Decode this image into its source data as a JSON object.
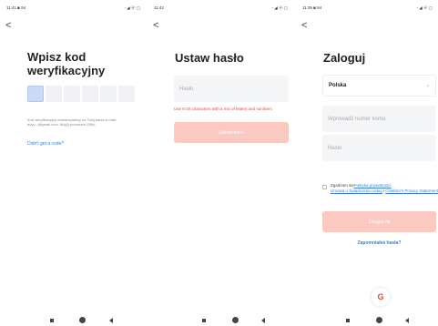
{
  "screen1": {
    "status_time": "11:41 ◙ 94",
    "status_right": "◦ ◢ ⓦ ▢",
    "back_glyph": "<",
    "title": "Wpisz kod weryfikacyjny",
    "code_boxes": 6,
    "info": "Kod weryfikacyjny został wysłany na Twój adres e-mail: adyv...@gmail.com. Mój(i) ponownie (59s)",
    "link": "Didn't get a code?"
  },
  "screen2": {
    "status_time": "11:42",
    "status_right": "◦ ◢ ⓦ ▢",
    "back_glyph": "<",
    "title": "Ustaw hasło",
    "password_placeholder": "Hasło",
    "hint": "Use 6-20 characters with a mix of letters and numbers",
    "button": "Zakończono"
  },
  "screen3": {
    "status_time": "11:39 ◙ 94",
    "status_right": "◦ ◢ ⓦ ▢",
    "back_glyph": "<",
    "title": "Zaloguj",
    "country": "Polska",
    "chevron": "⌄",
    "account_placeholder": "Wprowadź numer konta",
    "password_placeholder": "Hasło",
    "terms_prefix": "Zgadzam się",
    "terms_link1": "Polityka prywatności",
    "terms_link2": "Umowa o świadczeniu usług",
    "terms_sep": " i ",
    "terms_link3": "Children's Privacy Statement",
    "login_button": "Zaloguj się",
    "forgot": "Zapomniałeś hasła?",
    "google_glyph": "G"
  },
  "colors": {
    "accent_blue": "#3a7ee4",
    "button_disabled": "#fbc9c0",
    "error_red": "#e24a3b",
    "field_bg": "#f4f5f7"
  }
}
